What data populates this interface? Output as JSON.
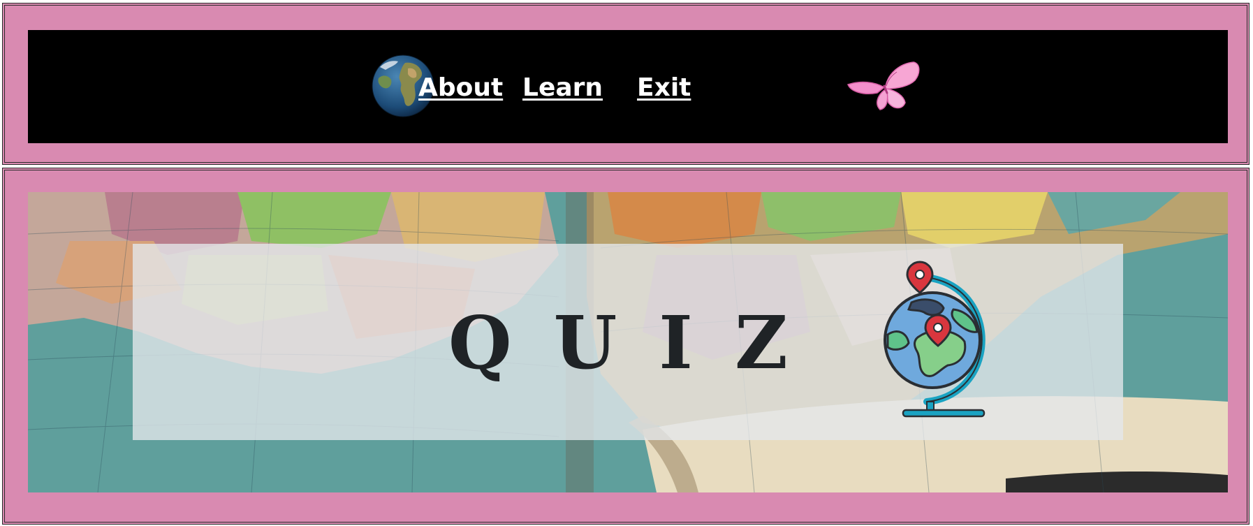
{
  "nav": {
    "links": [
      "About",
      "Learn",
      "Exit"
    ],
    "earth_icon": "earth-globe-icon",
    "butterfly_icon": "butterfly-icon"
  },
  "hero": {
    "title": "QUIZ",
    "globe_icon": "globe-with-pins-icon",
    "background": "atlas-map-photo"
  },
  "colors": {
    "frame": "#d98ab1",
    "nav_bg": "#000000",
    "nav_text": "#ffffff",
    "panel": "#e4e8ec",
    "title_text": "#1f2326"
  }
}
